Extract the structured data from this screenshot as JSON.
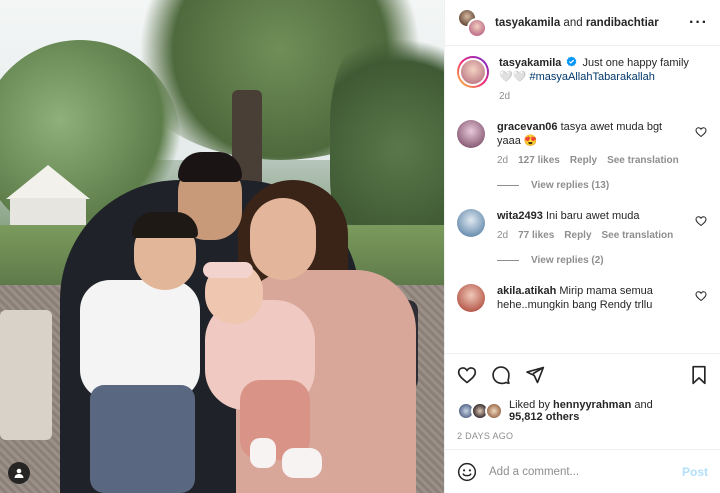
{
  "header": {
    "user1": "tasyakamila",
    "conj": "and",
    "user2": "randibachtiar",
    "more_icon": "more-dots-icon"
  },
  "caption": {
    "username": "tasyakamila",
    "verified_icon": "verified-badge-icon",
    "text": "Just one happy family",
    "emoji": "🤍🤍",
    "hashtag": "#masyaAllahTabarakallah",
    "age": "2d"
  },
  "comments": [
    {
      "username": "gracevan06",
      "text": "tasya awet muda bgt yaaa 😍",
      "age": "2d",
      "likes": "127 likes",
      "reply": "Reply",
      "translate": "See translation",
      "replies": "View replies (13)",
      "avatar_color": "#b88aa0"
    },
    {
      "username": "wita2493",
      "text": "Ini baru awet muda",
      "age": "2d",
      "likes": "77 likes",
      "reply": "Reply",
      "translate": "See translation",
      "replies": "View replies (2)",
      "avatar_color": "#6b8fb0"
    },
    {
      "username": "akila.atikah",
      "text": "Mirip mama semua hehe..mungkin bang Rendy trllu",
      "avatar_color": "#b65a4c"
    }
  ],
  "likes": {
    "prefix": "Liked by",
    "user": "hennyyrahman",
    "middle": "and",
    "count": "95,812 others"
  },
  "timestamp": "2 DAYS AGO",
  "add_comment": {
    "placeholder": "Add a comment...",
    "post_label": "Post"
  },
  "colors": {
    "link": "#00376b",
    "muted": "#8e8e8e",
    "post_disabled": "#b2dffc",
    "verified": "#0095f6"
  }
}
